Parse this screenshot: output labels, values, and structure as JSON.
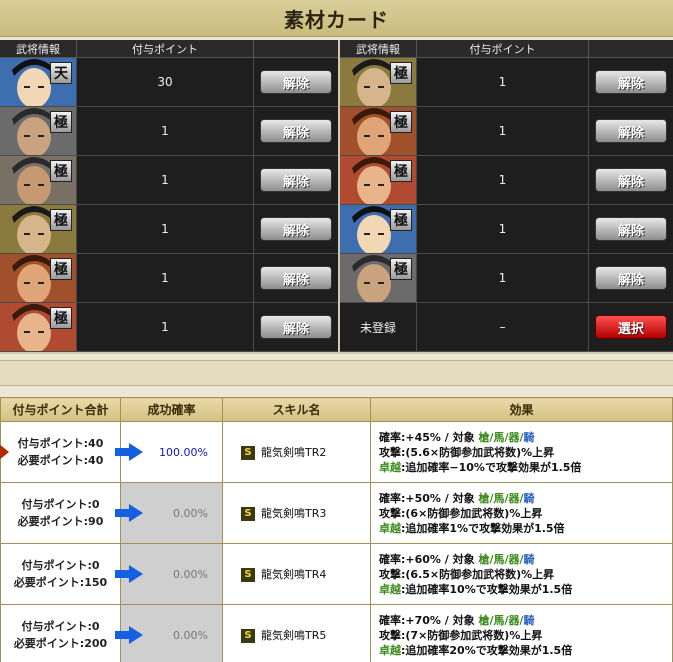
{
  "header": {
    "title": "素材カード"
  },
  "material": {
    "col_info": "武将情報",
    "col_point": "付与ポイント",
    "cancel_label": "解除",
    "select_label": "選択",
    "unregistered_label": "未登録",
    "unregistered_point": "–",
    "left": [
      {
        "rank": "天",
        "point": "30"
      },
      {
        "rank": "極",
        "point": "1"
      },
      {
        "rank": "極",
        "point": "1"
      },
      {
        "rank": "極",
        "point": "1"
      },
      {
        "rank": "極",
        "point": "1"
      },
      {
        "rank": "極",
        "point": "1"
      }
    ],
    "right": [
      {
        "rank": "極",
        "point": "1"
      },
      {
        "rank": "極",
        "point": "1"
      },
      {
        "rank": "極",
        "point": "1"
      },
      {
        "rank": "極",
        "point": "1"
      },
      {
        "rank": "極",
        "point": "1"
      }
    ]
  },
  "skills": {
    "headers": {
      "point_total": "付与ポイント合計",
      "rate": "成功確率",
      "name": "スキル名",
      "effect": "効果"
    },
    "rows": [
      {
        "given": "付与ポイント:40",
        "need": "必要ポイント:40",
        "rate": "100.00%",
        "name": "龍気剣鳴TR2",
        "eff1_prefix": "確率:+45% / 対象 ",
        "target_a": "槍/馬/器/",
        "target_b": "騎",
        "eff2": "攻撃:(5.6×防御参加武将数)%上昇",
        "eff3_label": "卓越",
        "eff3": ":追加確率−10%で攻撃効果が1.5倍"
      },
      {
        "given": "付与ポイント:0",
        "need": "必要ポイント:90",
        "rate": "0.00%",
        "name": "龍気剣鳴TR3",
        "eff1_prefix": "確率:+50% / 対象 ",
        "target_a": "槍/馬/器/",
        "target_b": "騎",
        "eff2": "攻撃:(6×防御参加武将数)%上昇",
        "eff3_label": "卓越",
        "eff3": ":追加確率1%で攻撃効果が1.5倍"
      },
      {
        "given": "付与ポイント:0",
        "need": "必要ポイント:150",
        "rate": "0.00%",
        "name": "龍気剣鳴TR4",
        "eff1_prefix": "確率:+60% / 対象 ",
        "target_a": "槍/馬/器/",
        "target_b": "騎",
        "eff2": "攻撃:(6.5×防御参加武将数)%上昇",
        "eff3_label": "卓越",
        "eff3": ":追加確率10%で攻撃効果が1.5倍"
      },
      {
        "given": "付与ポイント:0",
        "need": "必要ポイント:200",
        "rate": "0.00%",
        "name": "龍気剣鳴TR5",
        "eff1_prefix": "確率:+70% / 対象 ",
        "target_a": "槍/馬/器/",
        "target_b": "騎",
        "eff2": "攻撃:(7×防御参加武将数)%上昇",
        "eff3_label": "卓越",
        "eff3": ":追加確率20%で攻撃効果が1.5倍"
      }
    ]
  },
  "colors": {
    "accent": "#1212c8",
    "select_red": "#d00000",
    "panel_dark": "#1e1e1e"
  }
}
